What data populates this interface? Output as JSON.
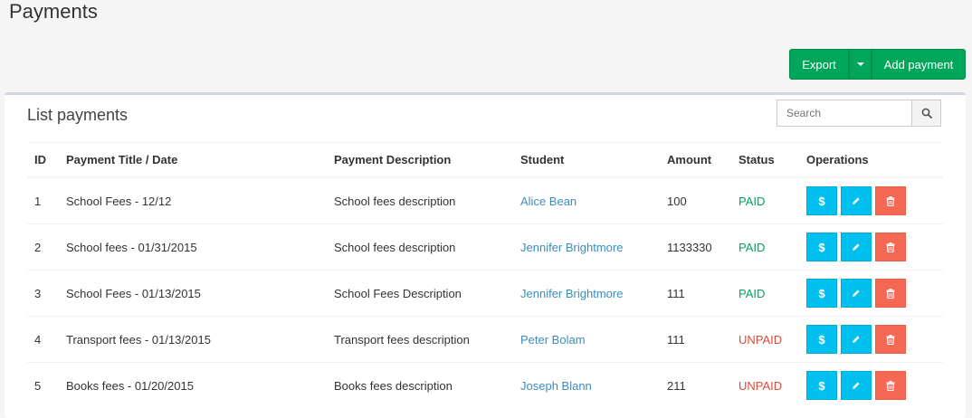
{
  "page": {
    "title": "Payments"
  },
  "actions": {
    "export_label": "Export",
    "add_label": "Add payment"
  },
  "box": {
    "title": "List payments",
    "search": {
      "placeholder": "Search",
      "value": ""
    }
  },
  "table": {
    "headers": [
      "ID",
      "Payment Title / Date",
      "Payment Description",
      "Student",
      "Amount",
      "Status",
      "Operations"
    ],
    "rows": [
      {
        "id": "1",
        "title": "School Fees - 12/12",
        "description": "School fees description",
        "student": "Alice Bean",
        "amount": "100",
        "status": "PAID"
      },
      {
        "id": "2",
        "title": "School fees - 01/31/2015",
        "description": "School fees description",
        "student": "Jennifer Brightmore",
        "amount": "1133330",
        "status": "PAID"
      },
      {
        "id": "3",
        "title": "School Fees - 01/13/2015",
        "description": "School Fees Description",
        "student": "Jennifer Brightmore",
        "amount": "111",
        "status": "PAID"
      },
      {
        "id": "4",
        "title": "Transport fees - 01/13/2015",
        "description": "Transport fees description",
        "student": "Peter Bolam",
        "amount": "111",
        "status": "UNPAID"
      },
      {
        "id": "5",
        "title": "Books fees - 01/20/2015",
        "description": "Books fees description",
        "student": "Joseph Blann",
        "amount": "211",
        "status": "UNPAID"
      }
    ]
  },
  "icons": {
    "pay": "dollar-icon",
    "edit": "pencil-icon",
    "delete": "trash-icon"
  },
  "colors": {
    "green": "#00a65a",
    "info": "#00c0ef",
    "danger": "#f56954",
    "link": "#3c8dbc",
    "unpaid": "#dd4b39"
  }
}
